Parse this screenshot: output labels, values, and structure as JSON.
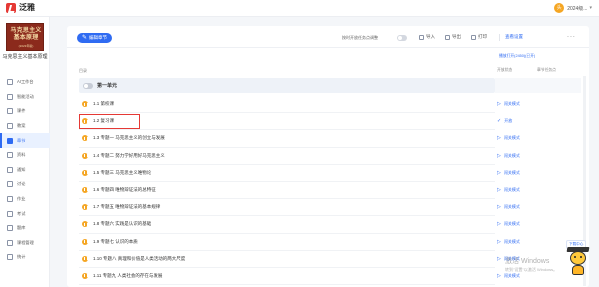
{
  "app": {
    "name": "泛雅",
    "brand_color": "#e53935"
  },
  "user": {
    "avatar_text": "头",
    "name": "2024级..."
  },
  "course": {
    "cover_title": "马克思主义基本原理",
    "cover_edition": "(2023年版)",
    "name": "马克思主义基本原理"
  },
  "sidebar": {
    "items": [
      {
        "label": "AI工作台",
        "icon": "ai-icon"
      },
      {
        "label": "智能活动",
        "icon": "activity-icon"
      },
      {
        "label": "课件",
        "icon": "courseware-icon"
      },
      {
        "label": "教案",
        "icon": "lesson-plan-icon"
      },
      {
        "label": "章节",
        "icon": "chapter-icon",
        "active": true
      },
      {
        "label": "资料",
        "icon": "materials-icon"
      },
      {
        "label": "通知",
        "icon": "notice-icon"
      },
      {
        "label": "讨论",
        "icon": "discussion-icon"
      },
      {
        "label": "作业",
        "icon": "homework-icon"
      },
      {
        "label": "考试",
        "icon": "exam-icon"
      },
      {
        "label": "题库",
        "icon": "question-bank-icon"
      },
      {
        "label": "课程管理",
        "icon": "course-manage-icon"
      },
      {
        "label": "统计",
        "icon": "stats-icon"
      }
    ]
  },
  "toolbar": {
    "edit_button": "编辑章节",
    "switch_label": "按时开放任务点调整",
    "import": "导入",
    "export": "导出",
    "print": "打印",
    "settings": "查看设置",
    "more": "..."
  },
  "schedule_link": "播放打开(2450)(已开)",
  "columns": {
    "dir": "目录",
    "status": "开放状态",
    "task": "章节任务点"
  },
  "unit": {
    "title": "第一单元"
  },
  "chapters": [
    {
      "title": "1.1 第校课",
      "status": "闯关模式",
      "status_icon": "play-icon"
    },
    {
      "title": "1.2 复习课",
      "status": "开放",
      "status_icon": "check-icon",
      "selected": true
    },
    {
      "title": "1.3 专题一 马克思主义的创立与发展",
      "status": "闯关模式",
      "status_icon": "play-icon"
    },
    {
      "title": "1.4 专题二 努力学好用好马克思主义",
      "status": "闯关模式",
      "status_icon": "play-icon"
    },
    {
      "title": "1.5 专题三 马克思主义唯物论",
      "status": "闯关模式",
      "status_icon": "play-icon"
    },
    {
      "title": "1.6 专题四 唯物辩证法的总特征",
      "status": "闯关模式",
      "status_icon": "play-icon"
    },
    {
      "title": "1.7 专题五 唯物辩证法的基本规律",
      "status": "闯关模式",
      "status_icon": "play-icon"
    },
    {
      "title": "1.8 专题六 实践是认识的基础",
      "status": "闯关模式",
      "status_icon": "play-icon"
    },
    {
      "title": "1.9 专题七 认识的本质",
      "status": "闯关模式",
      "status_icon": "play-icon"
    },
    {
      "title": "1.10 专题八 真理和价值是人类活动的两大尺度",
      "status": "闯关模式",
      "status_icon": "play-icon"
    },
    {
      "title": "1.11 专题九 人类社会的存在与发展",
      "status": "闯关模式",
      "status_icon": "play-icon"
    }
  ],
  "helper": {
    "label": "下载中心"
  },
  "watermark": {
    "line1": "激活 Windows",
    "line2": "转到\"设置\"以激活 Windows。"
  }
}
